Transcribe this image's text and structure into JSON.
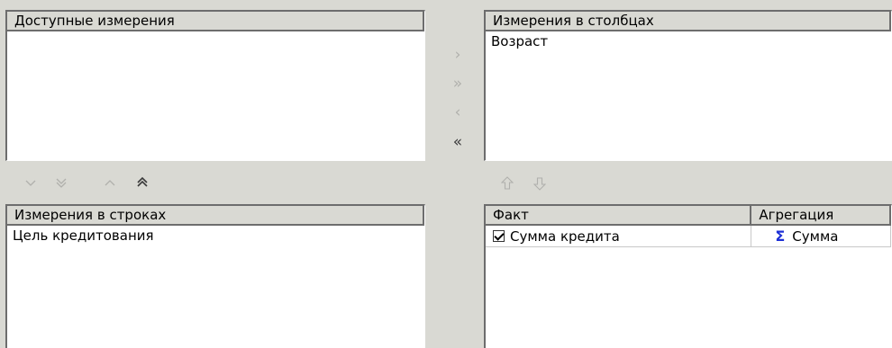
{
  "available": {
    "header": "Доступные измерения",
    "items": []
  },
  "columns": {
    "header": "Измерения в столбцах",
    "items": [
      "Возраст"
    ]
  },
  "rows": {
    "header": "Измерения в строках",
    "items": [
      "Цель кредитования"
    ]
  },
  "facts": {
    "columns": [
      "Факт",
      "Агрегация"
    ],
    "rows": [
      {
        "checked": true,
        "fact": "Сумма кредита",
        "aggregation": "Сумма"
      }
    ]
  },
  "transfer_buttons": {
    "move_right": {
      "glyph": "›",
      "enabled": false
    },
    "move_all_right": {
      "glyph": "»",
      "enabled": false
    },
    "move_left": {
      "glyph": "‹",
      "enabled": false
    },
    "move_all_left": {
      "glyph": "«",
      "enabled": true
    }
  },
  "row_buttons": {
    "move_down": {
      "icon": "chevron-down-icon",
      "enabled": false
    },
    "move_all_down": {
      "icon": "double-chevron-down-icon",
      "enabled": false
    },
    "move_up": {
      "icon": "chevron-up-icon",
      "enabled": false
    },
    "move_all_up": {
      "icon": "double-chevron-up-icon",
      "enabled": true
    }
  },
  "fact_buttons": {
    "move_up": {
      "icon": "arrow-up-icon",
      "enabled": false
    },
    "move_down": {
      "icon": "arrow-down-icon",
      "enabled": false
    }
  },
  "aggregation_icon": {
    "glyph": "Σ",
    "color": "#1c2fd6"
  }
}
